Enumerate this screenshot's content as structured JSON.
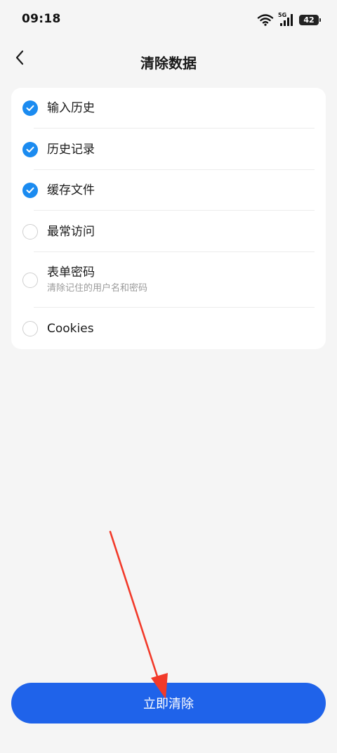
{
  "status_bar": {
    "time": "09:18",
    "network": "5G",
    "battery": "42"
  },
  "header": {
    "title": "清除数据"
  },
  "options": [
    {
      "label": "输入历史",
      "checked": true
    },
    {
      "label": "历史记录",
      "checked": true
    },
    {
      "label": "缓存文件",
      "checked": true
    },
    {
      "label": "最常访问",
      "checked": false
    },
    {
      "label": "表单密码",
      "description": "清除记住的用户名和密码",
      "checked": false
    },
    {
      "label": "Cookies",
      "checked": false
    }
  ],
  "actions": {
    "clear_label": "立即清除"
  },
  "colors": {
    "accent": "#1b8bf0",
    "button": "#1f63ea",
    "annotation_arrow": "#f23a2a"
  }
}
